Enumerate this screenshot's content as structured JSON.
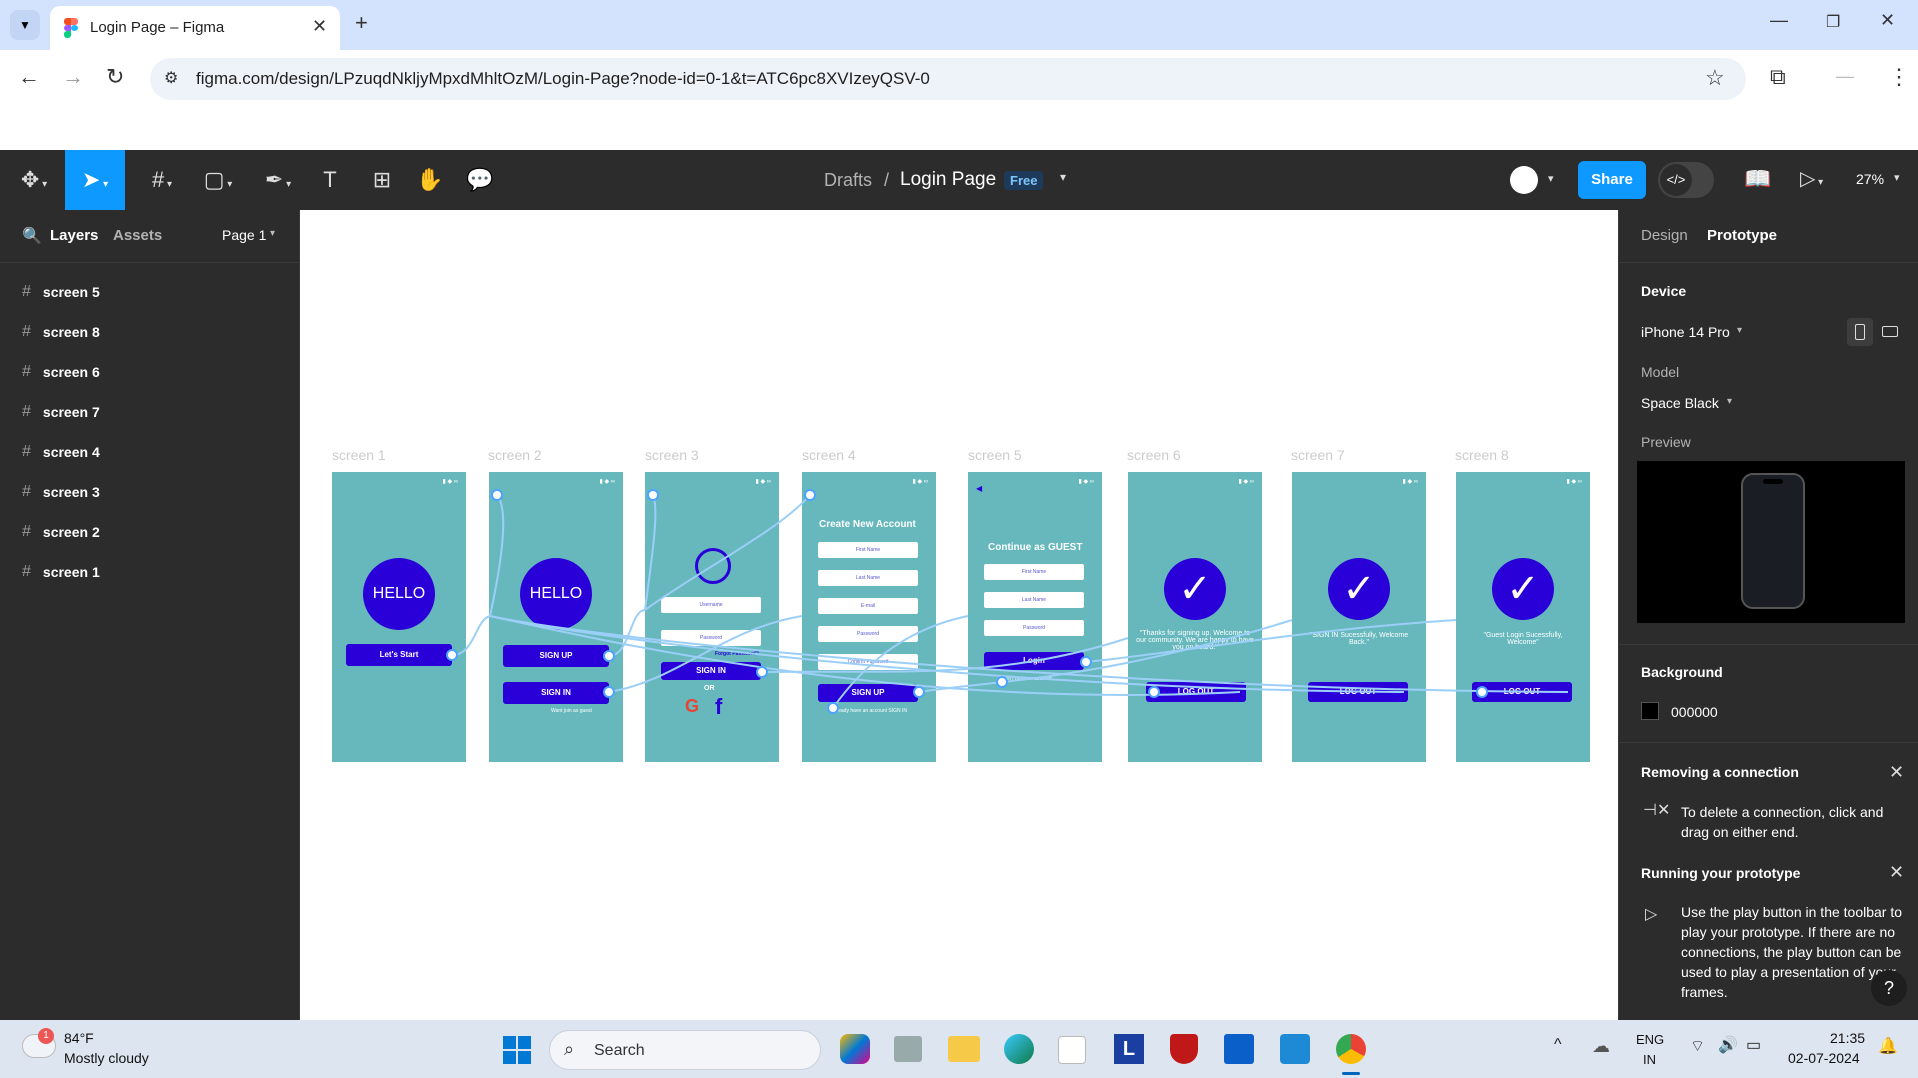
{
  "browser": {
    "tab_title": "Login Page – Figma",
    "url": "figma.com/design/LPzuqdNkljyMpxdMhltOzM/Login-Page?node-id=0-1&t=ATC6pc8XVIzeyQSV-0"
  },
  "toolbar": {
    "breadcrumb_parent": "Drafts",
    "breadcrumb_sep": "/",
    "file_name": "Login Page",
    "plan_badge": "Free",
    "share_label": "Share",
    "zoom": "27%"
  },
  "left_panel": {
    "tab_layers": "Layers",
    "tab_assets": "Assets",
    "page_selector": "Page 1",
    "layers": [
      "screen 5",
      "screen 8",
      "screen 6",
      "screen 7",
      "screen 4",
      "screen 3",
      "screen 2",
      "screen 1"
    ]
  },
  "canvas": {
    "frames": [
      {
        "label": "screen 1",
        "circle_text": "HELLO",
        "buttons": [
          "Let's Start"
        ]
      },
      {
        "label": "screen 2",
        "circle_text": "HELLO",
        "buttons": [
          "SIGN UP",
          "SIGN IN"
        ],
        "footer": "Want join as guest"
      },
      {
        "label": "screen 3",
        "inputs": [
          "Username",
          "Password"
        ],
        "link": "Forgot Password?",
        "buttons": [
          "SIGN IN"
        ],
        "or": "OR"
      },
      {
        "label": "screen 4",
        "title": "Create New Account",
        "inputs": [
          "First Name",
          "Last Name",
          "E-mail",
          "Password",
          "Confirm Password"
        ],
        "buttons": [
          "SIGN UP"
        ],
        "footer": "Already have an account SIGN IN"
      },
      {
        "label": "screen 5",
        "title": "Continue as GUEST",
        "inputs": [
          "First Name",
          "Last Name",
          "Password"
        ],
        "buttons": [
          "Login"
        ],
        "footer": "Don't have an account"
      },
      {
        "label": "screen 6",
        "message": "\"Thanks for signing up. Welcome to our community. We are happy to have you on board.\"",
        "buttons": [
          "LOG OUT"
        ]
      },
      {
        "label": "screen 7",
        "message": "\"SIGN IN Sucessfully, Welcome Back.\"",
        "buttons": [
          "LOG OUT"
        ]
      },
      {
        "label": "screen 8",
        "message": "\"Guest Login Sucessfully, Welcome\"",
        "buttons": [
          "LOG OUT"
        ]
      }
    ]
  },
  "right_panel": {
    "tab_design": "Design",
    "tab_prototype": "Prototype",
    "device_heading": "Device",
    "device_value": "iPhone 14 Pro",
    "model_heading": "Model",
    "model_value": "Space Black",
    "preview_heading": "Preview",
    "background_heading": "Background",
    "background_value": "000000",
    "tip1_title": "Removing a connection",
    "tip1_body": "To delete a connection, click and drag on either end.",
    "tip2_title": "Running your prototype",
    "tip2_body": "Use the play button in the toolbar to play your prototype. If there are no connections, the play button can be used to play a presentation of your frames.",
    "help": "?"
  },
  "taskbar": {
    "weather_temp": "84°F",
    "weather_desc": "Mostly cloudy",
    "weather_badge": "1",
    "search_label": "Search",
    "lang_top": "ENG",
    "lang_bottom": "IN",
    "time": "21:35",
    "date": "02-07-2024"
  },
  "colors": {
    "figma_dark": "#2c2c2c",
    "share_blue": "#0d99ff",
    "phone_teal": "#66b8bd",
    "accent_indigo": "#2a00d9"
  }
}
